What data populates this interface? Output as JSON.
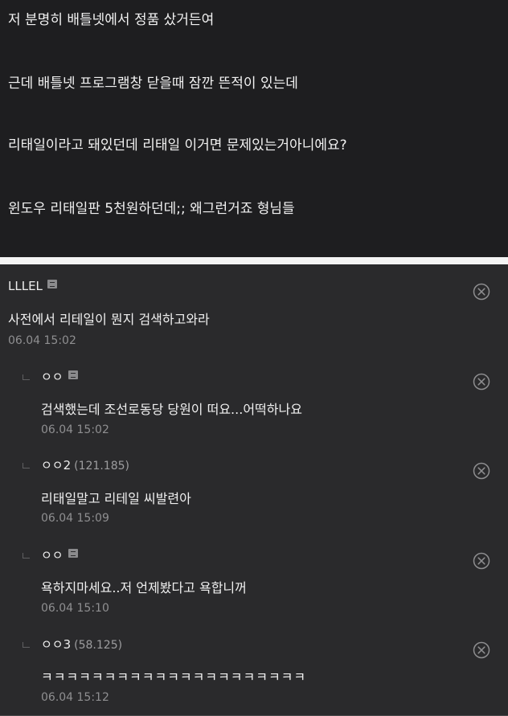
{
  "post": {
    "lines": [
      "저 분명히 배틀넷에서 정품 샀거든여",
      "근데 배틀넷 프로그램창 닫을때 잠깐 뜬적이 있는데",
      "리태일이라고 돼있던데 리태일 이거면 문제있는거아니에요?",
      "윈도우 리태일판 5천원하던데;; 왜그런거죠 형님들"
    ]
  },
  "comments": [
    {
      "author": "LLLEL",
      "ip": "",
      "has_badge": true,
      "text": "사전에서 리테일이 뭔지 검색하고와라",
      "date": "06.04 15:02",
      "reply": false,
      "delete_icon": "close-circle-icon"
    },
    {
      "author": "ㅇㅇ",
      "ip": "",
      "has_badge": true,
      "text": "검색했는데 조선로동당 당원이 떠요...어떡하나요",
      "date": "06.04 15:02",
      "reply": true,
      "delete_icon": "close-circle-icon"
    },
    {
      "author": "ㅇㅇ2",
      "ip": "(121.185)",
      "has_badge": false,
      "text": "리태일말고 리테일 씨발련아",
      "date": "06.04 15:09",
      "reply": true,
      "delete_icon": "close-circle-icon"
    },
    {
      "author": "ㅇㅇ",
      "ip": "",
      "has_badge": true,
      "text": "욕하지마세요..저 언제봤다고 욕합니꺼",
      "date": "06.04 15:10",
      "reply": true,
      "delete_icon": "close-circle-icon"
    },
    {
      "author": "ㅇㅇ3",
      "ip": "(58.125)",
      "has_badge": false,
      "text": "ㅋㅋㅋㅋㅋㅋㅋㅋㅋㅋㅋㅋㅋㅋㅋㅋㅋㅋㅋㅋㅋ",
      "date": "06.04 15:12",
      "reply": true,
      "delete_icon": "close-circle-icon"
    }
  ],
  "colors": {
    "background": "#1f1f21",
    "comment_bg": "#2a2a2c",
    "separator": "#f4f4f4",
    "muted_text": "#8f8f91"
  }
}
